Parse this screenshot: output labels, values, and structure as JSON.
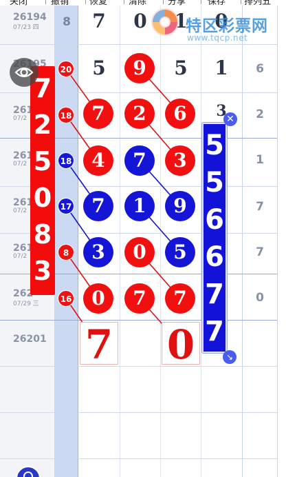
{
  "toolbar": {
    "close_label": "关闭",
    "undo_label": "撤销",
    "restore_label": "恢复",
    "clear_label": "清除",
    "share_label": "分享",
    "save_label": "保存",
    "game_label": "排列五"
  },
  "watermark": {
    "site_name": "特区彩票网",
    "url": "www.tqcp.net"
  },
  "rows": [
    {
      "issue": "26194",
      "date": "07/23 四",
      "sum": "8",
      "d1": "7",
      "d2": "0",
      "d3": "1",
      "d4": "0",
      "right": ""
    },
    {
      "issue": "26195",
      "date": "",
      "sum": "20",
      "d1": "5",
      "d2": "9",
      "d3": "5",
      "d4": "1",
      "right": "6"
    },
    {
      "issue": "261",
      "date": "07/2",
      "sum": "18",
      "d1": "7",
      "d2": "2",
      "d3": "6",
      "d4": "3",
      "right": "2"
    },
    {
      "issue": "261",
      "date": "07/2",
      "sum": "18",
      "d1": "4",
      "d2": "7",
      "d3": "3",
      "d4": "",
      "right": "1"
    },
    {
      "issue": "261",
      "date": "07/2",
      "sum": "17",
      "d1": "7",
      "d2": "1",
      "d3": "9",
      "d4": "",
      "right": "7"
    },
    {
      "issue": "261",
      "date": "07/2",
      "sum": "8",
      "d1": "3",
      "d2": "0",
      "d3": "5",
      "d4": "",
      "right": "7"
    },
    {
      "issue": "262",
      "date": "07/29 三",
      "sum": "16",
      "d1": "0",
      "d2": "7",
      "d3": "7",
      "d4": "",
      "right": "0"
    }
  ],
  "next_issue": "26201",
  "predictions": {
    "d1": "7",
    "d3": "0"
  },
  "left_strip": [
    "7",
    "2",
    "5",
    "0",
    "8",
    "3"
  ],
  "right_strip": [
    "5",
    "5",
    "6",
    "6",
    "7",
    "7"
  ],
  "icons": {
    "eye": "eye-icon",
    "close": "close-icon",
    "resize": "resize-icon",
    "fab": "edit-fab-icon",
    "logo": "swirl-logo-icon"
  },
  "colors": {
    "red_ball": "#f20f0f",
    "blue_ball": "#1515d8",
    "sum_column": "#cbd9f2",
    "accent_handle": "#4b5cf0"
  }
}
